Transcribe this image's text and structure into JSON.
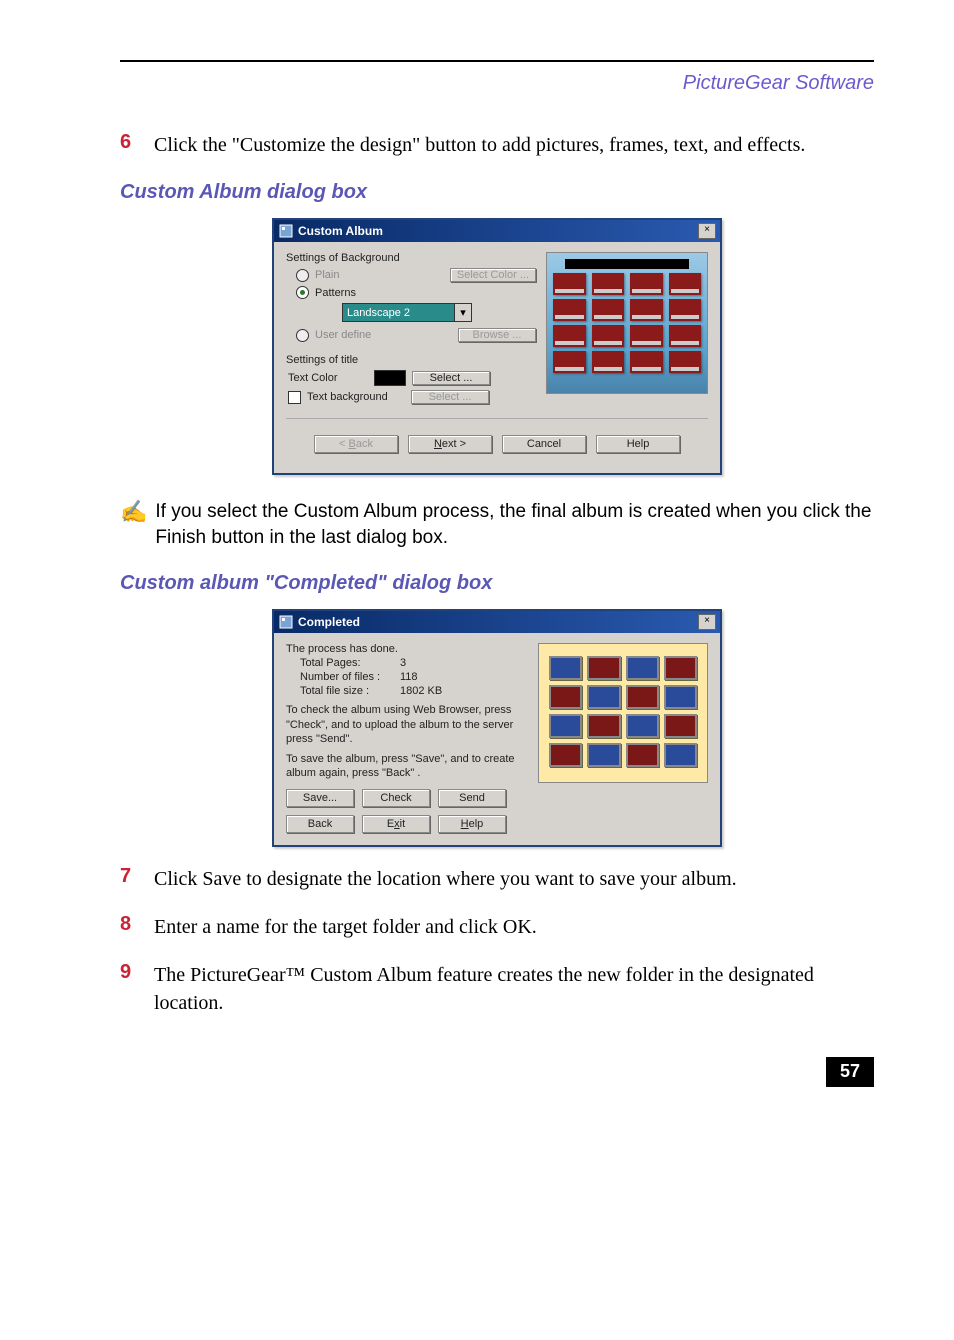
{
  "header": {
    "category": "PictureGear Software"
  },
  "steps": {
    "s6": {
      "num": "6",
      "text": "Click the \"Customize the design\" button to add pictures, frames, text, and effects."
    },
    "s7": {
      "num": "7",
      "text": "Click Save to designate the location where you want to save your album."
    },
    "s8": {
      "num": "8",
      "text": "Enter a name for the target folder and click OK."
    },
    "s9": {
      "num": "9",
      "text": "The PictureGear™ Custom Album feature creates the new folder in the designated location."
    }
  },
  "sections": {
    "s1": "Custom Album dialog box",
    "s2": "Custom album \"Completed\" dialog box"
  },
  "note": "If you select the Custom Album process, the final album is created when you click the Finish button in the last dialog box.",
  "dlg1": {
    "title": "Custom Album",
    "group_bg": "Settings of Background",
    "opt_plain": "Plain",
    "btn_select_color": "Select Color ...",
    "opt_patterns": "Patterns",
    "pattern_value": "Landscape 2",
    "opt_user": "User define",
    "btn_browse": "Browse ...",
    "group_title": "Settings of title",
    "lbl_text_color": "Text Color",
    "btn_select": "Select ...",
    "chk_text_bg": "Text background",
    "btn_select2": "Select ...",
    "buttons": {
      "back_prefix": "< ",
      "back_u": "B",
      "back_rest": "ack",
      "next_u": "N",
      "next_rest": "ext >",
      "cancel": "Cancel",
      "help": "Help"
    }
  },
  "dlg2": {
    "title": "Completed",
    "done": "The process has done.",
    "pages_k": "Total Pages:",
    "pages_v": "3",
    "files_k": "Number of files :",
    "files_v": "118",
    "size_k": "Total file size :",
    "size_v": "1802 KB",
    "tip1": "To check the album using Web Browser, press \"Check\", and to upload the album to the server press \"Send\".",
    "tip2": "To save the album, press \"Save\", and to create album again, press \"Back\" .",
    "btns": {
      "save": "Save...",
      "check": "Check",
      "send": "Send",
      "back": "Back",
      "exit_pre": "E",
      "exit_u": "x",
      "exit_post": "it",
      "help_u": "H",
      "help_rest": "elp"
    }
  },
  "page_number": "57"
}
